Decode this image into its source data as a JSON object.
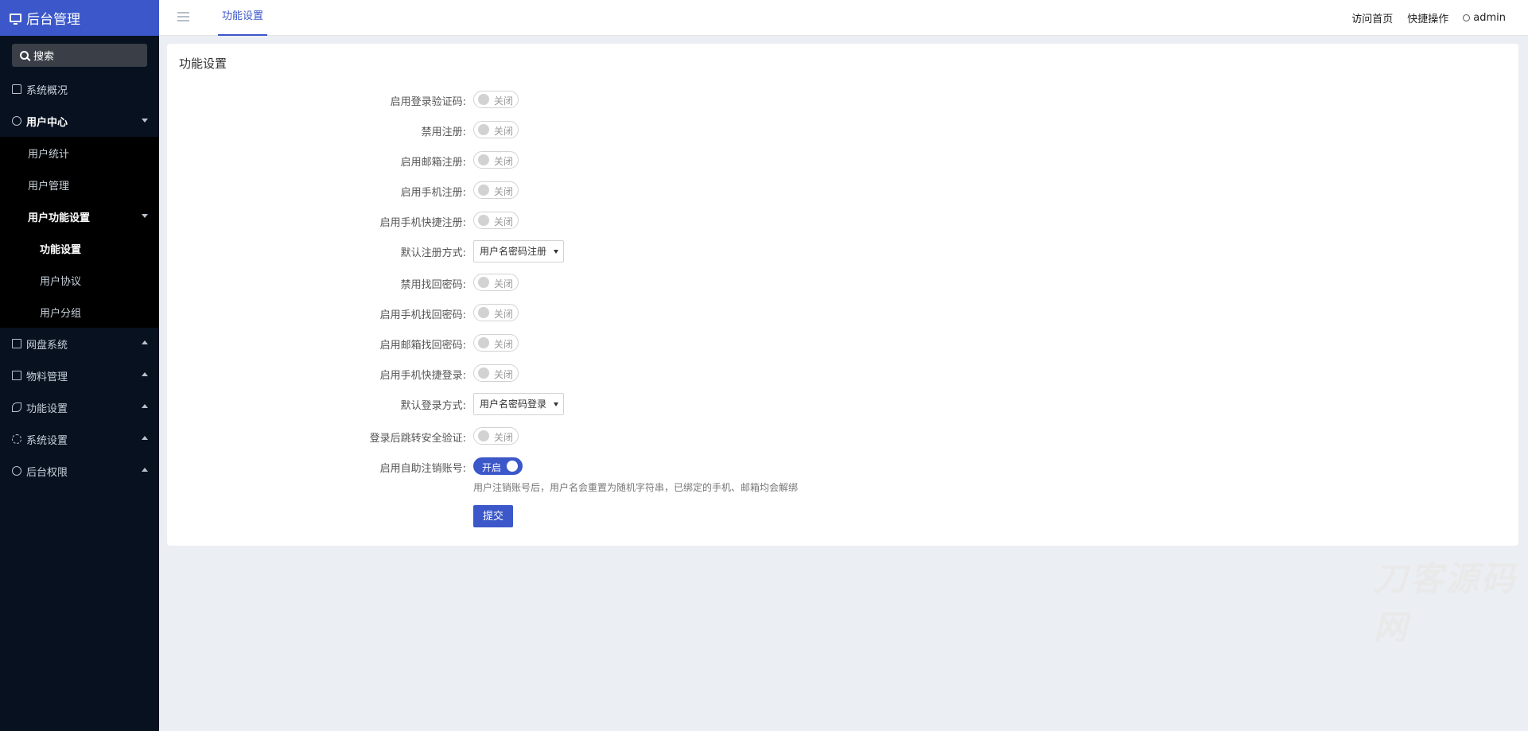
{
  "brand": {
    "title": "后台管理"
  },
  "sidebar": {
    "search_placeholder": "搜索",
    "items": [
      {
        "label": "系统概况"
      },
      {
        "label": "用户中心"
      },
      {
        "label": "用户统计"
      },
      {
        "label": "用户管理"
      },
      {
        "label": "用户功能设置"
      },
      {
        "label": "功能设置"
      },
      {
        "label": "用户协议"
      },
      {
        "label": "用户分组"
      },
      {
        "label": "网盘系统"
      },
      {
        "label": "物料管理"
      },
      {
        "label": "功能设置"
      },
      {
        "label": "系统设置"
      },
      {
        "label": "后台权限"
      }
    ]
  },
  "topbar": {
    "tab": "功能设置",
    "links": [
      "访问首页",
      "快捷操作",
      "admin"
    ]
  },
  "form": {
    "title": "功能设置",
    "rows": [
      {
        "label": "启用登录验证码:",
        "state": "关闭"
      },
      {
        "label": "禁用注册:",
        "state": "关闭"
      },
      {
        "label": "启用邮箱注册:",
        "state": "关闭"
      },
      {
        "label": "启用手机注册:",
        "state": "关闭"
      },
      {
        "label": "启用手机快捷注册:",
        "state": "关闭"
      },
      {
        "label": "默认注册方式:",
        "select": "用户名密码注册"
      },
      {
        "label": "禁用找回密码:",
        "state": "关闭"
      },
      {
        "label": "启用手机找回密码:",
        "state": "关闭"
      },
      {
        "label": "启用邮箱找回密码:",
        "state": "关闭"
      },
      {
        "label": "启用手机快捷登录:",
        "state": "关闭"
      },
      {
        "label": "默认登录方式:",
        "select": "用户名密码登录"
      },
      {
        "label": "登录后跳转安全验证:",
        "state": "关闭"
      },
      {
        "label": "启用自助注销账号:",
        "state": "开启"
      }
    ],
    "hint": "用户注销账号后，用户名会重置为随机字符串，已绑定的手机、邮箱均会解绑",
    "submit": "提交"
  },
  "watermark": "刀客源码网",
  "colors": {
    "accent": "#3b57c9",
    "sidebar_bg": "#07111f",
    "page_bg": "#ebeef3"
  }
}
